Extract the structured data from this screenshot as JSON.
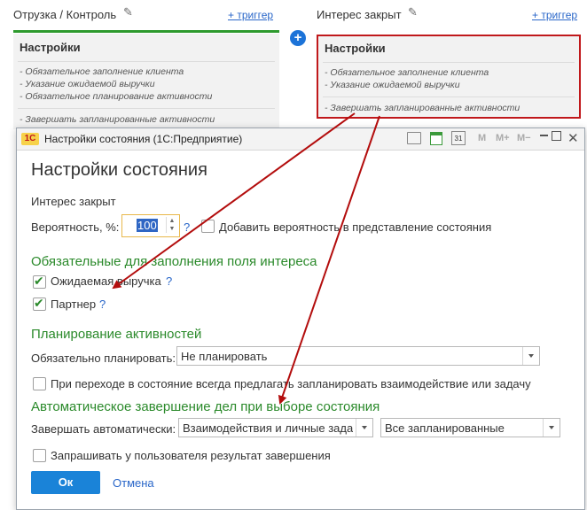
{
  "board": {
    "left_column": {
      "title": "Отрузка / Контроль",
      "trigger": "+ триггер",
      "card": {
        "header": "Настройки",
        "items": [
          "- Обязательное заполнение клиента",
          "- Указание ожидаемой выручки",
          "- Обязательное планирование активности"
        ],
        "footer": "- Завершать запланированные активности"
      }
    },
    "right_column": {
      "title": "Интерес закрыт",
      "trigger": "+ триггер",
      "card": {
        "header": "Настройки",
        "items": [
          "- Обязательное заполнение клиента",
          "- Указание ожидаемой выручки"
        ],
        "footer": "- Завершать запланированные активности"
      }
    },
    "add_button": "+"
  },
  "dialog": {
    "app_icon": "1С",
    "title": "Настройки состояния (1С:Предприятие)",
    "toolbar": {
      "m": "M",
      "m_plus": "M+",
      "m_minus": "M−",
      "calendar_day": "31"
    },
    "heading": "Настройки состояния",
    "state_name": "Интерес закрыт",
    "probability": {
      "label": "Вероятность, %:",
      "value": "100",
      "help": "?",
      "add_checkbox_label": "Добавить вероятность в представление состояния",
      "add_checked": false
    },
    "required_section": {
      "title": "Обязательные для заполнения поля интереса",
      "fields": [
        {
          "label": "Ожидаемая выручка",
          "checked": true,
          "help": "?"
        },
        {
          "label": "Партнер",
          "checked": true,
          "help": "?"
        }
      ]
    },
    "planning_section": {
      "title": "Планирование активностей",
      "label": "Обязательно планировать:",
      "value": "Не планировать",
      "suggest_label": "При переходе в состояние всегда предлагать  запланировать взаимодействие или задачу",
      "suggest_checked": false
    },
    "auto_complete_section": {
      "title": "Автоматическое завершение дел при  выборе  состояния",
      "label": "Завершать автоматически:",
      "value1": "Взаимодействия и личные задачи",
      "value2": "Все запланированные",
      "ask_label": "Запрашивать у пользователя результат завершения",
      "ask_checked": false
    },
    "ok_label": "Ок",
    "cancel_label": "Отмена"
  },
  "colors": {
    "accent_green": "#2b8a2b",
    "link_blue": "#2a67c9",
    "highlight_red": "#c0181b",
    "arrow_red": "#b30d0d",
    "ok_blue": "#1a83d8"
  }
}
